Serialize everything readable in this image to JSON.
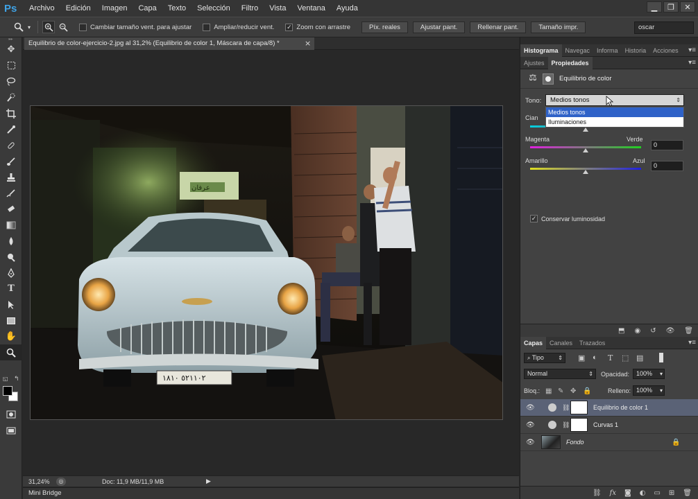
{
  "app": {
    "logo": "Ps"
  },
  "menu": [
    "Archivo",
    "Edición",
    "Imagen",
    "Capa",
    "Texto",
    "Selección",
    "Filtro",
    "Vista",
    "Ventana",
    "Ayuda"
  ],
  "window_controls": {
    "minimize": "▁",
    "restore": "❐",
    "close": "✕"
  },
  "options_bar": {
    "resize_windows": "Cambiar tamaño vent. para ajustar",
    "zoom_all": "Ampliar/reducir vent.",
    "scrubby_zoom": "Zoom con arrastre",
    "buttons": [
      "Píx. reales",
      "Ajustar pant.",
      "Rellenar pant.",
      "Tamaño impr."
    ],
    "user": "oscar"
  },
  "document": {
    "tab_title": "Equilibrio de color-ejercicio-2.jpg al 31,2% (Equilibrio de color 1, Máscara de capa/8) *",
    "tab_close": "×",
    "zoom": "31,24%",
    "doc_size": "Doc: 11,9 MB/11,9 MB",
    "mini_bridge": "Mini Bridge",
    "plate": "٥٢١١٠٢ ١٨١٠",
    "sign": "ﻋﺮﻓﺎﻥ"
  },
  "top_tabs": [
    "Histograma",
    "Navegac",
    "Informa",
    "Historia",
    "Acciones"
  ],
  "sub_tabs": [
    "Ajustes",
    "Propiedades"
  ],
  "properties": {
    "title": "Equilibrio de color",
    "tono_label": "Tono:",
    "tono_value": "Medios tonos",
    "tono_options": [
      "Medios tonos",
      "Iluminaciones"
    ],
    "sliders": [
      {
        "left": "Cian",
        "right": "Rojo",
        "value": "0"
      },
      {
        "left": "Magenta",
        "right": "Verde",
        "value": "0"
      },
      {
        "left": "Amarillo",
        "right": "Azul",
        "value": "0"
      }
    ],
    "preserve_label": "Conservar luminosidad",
    "preserve_checked": true
  },
  "layers_tabs": [
    "Capas",
    "Canales",
    "Trazados"
  ],
  "layers": {
    "filter_label": "Tipo",
    "blend_mode": "Normal",
    "opacity_label": "Opacidad:",
    "opacity_value": "100%",
    "lock_label": "Bloq.:",
    "fill_label": "Relleno:",
    "fill_value": "100%",
    "items": [
      {
        "name": "Equilibrio de color 1",
        "selected": true
      },
      {
        "name": "Curvas 1",
        "selected": false
      },
      {
        "name": "Fondo",
        "selected": false
      }
    ]
  },
  "colors": {
    "accent": "#2f62c8",
    "layer_selected": "#5a6276",
    "panel_bg": "#424242"
  }
}
